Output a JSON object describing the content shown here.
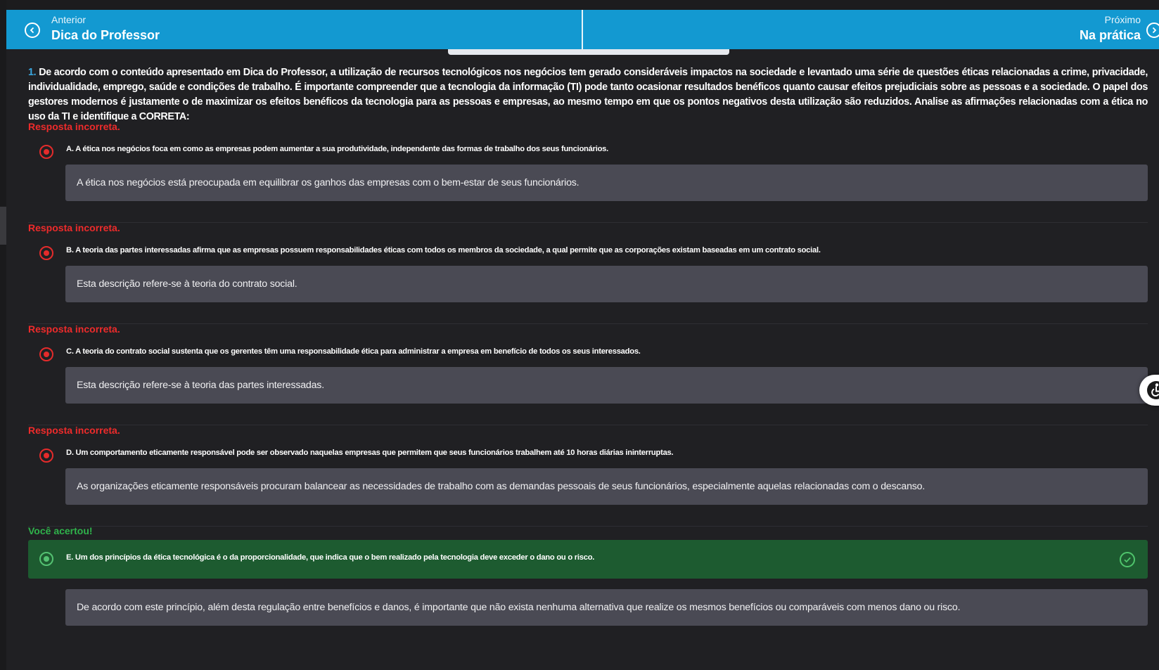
{
  "nav": {
    "prev_small": "Anterior",
    "prev_title": "Dica do Professor",
    "next_small": "Próximo",
    "next_title": "Na prática"
  },
  "question": {
    "number": "1.",
    "text": "De acordo com o conteúdo apresentado em Dica do Professor, a utilização de recursos tecnológicos nos negócios tem gerado consideráveis impactos na sociedade e levantado uma série de questões éticas relacionadas a crime, privacidade, individualidade, emprego, saúde e condições de trabalho. É importante compreender que a tecnologia da informação (TI) pode tanto ocasionar resultados benéficos quanto causar efeitos prejudiciais sobre as pessoas e a sociedade. O papel dos gestores modernos é justamente o de maximizar os efeitos benéficos da tecnologia para as pessoas e empresas, ao mesmo tempo em que os pontos negativos desta utilização são reduzidos. Analise as afirmações relacionadas com a ética no uso da TI e identifique a CORRETA:"
  },
  "options": [
    {
      "status": "Resposta incorreta.",
      "text": "A. A ética nos negócios foca em como as empresas podem aumentar a sua produtividade, independente das formas de trabalho dos seus funcionários.",
      "feedback": "A ética nos negócios está preocupada em equilibrar os ganhos das empresas com o bem-estar de seus funcionários."
    },
    {
      "status": "Resposta incorreta.",
      "text": "B. A teoria das partes interessadas afirma que as empresas possuem responsabilidades éticas com todos os membros da sociedade, a qual permite que as corporações existam baseadas em um contrato social.",
      "feedback": "Esta descrição refere-se à teoria do contrato social."
    },
    {
      "status": "Resposta incorreta.",
      "text": "C. A teoria do contrato social sustenta que os gerentes têm uma responsabilidade ética para administrar a empresa em benefício de todos os seus interessados.",
      "feedback": "Esta descrição refere-se à teoria das partes interessadas."
    },
    {
      "status": "Resposta incorreta.",
      "text": "D. Um comportamento eticamente responsável pode ser observado naquelas empresas que permitem que seus funcionários trabalhem até 10 horas diárias ininterruptas.",
      "feedback": "As organizações eticamente responsáveis procuram balancear as necessidades de trabalho com as demandas pessoais de seus funcionários, especialmente aquelas relacionadas com o descanso."
    },
    {
      "status": "Você acertou!",
      "text": "E. Um dos princípios da ética tecnológica é o da proporcionalidade, que indica que o bem realizado pela tecnologia deve exceder o dano ou o risco.",
      "feedback": "De acordo com este princípio, além desta regulação entre benefícios e danos, é importante que não exista nenhuma alternativa que realize os mesmos benefícios ou comparáveis com menos dano ou risco."
    }
  ],
  "colors": {
    "nav_blue": "#1399d1",
    "incorrect_red": "#ee2b2b",
    "correct_green": "#2fb24b",
    "correct_row_bg": "#1d5b30",
    "feedback_bg": "#4a4a54"
  }
}
